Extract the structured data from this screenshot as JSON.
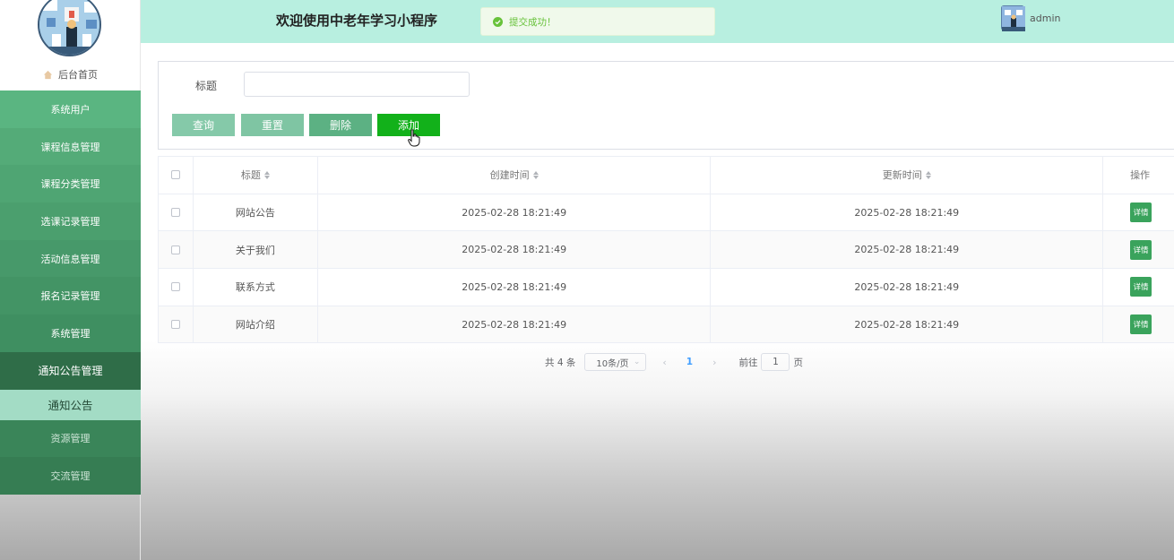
{
  "header": {
    "title": "欢迎使用中老年学习小程序",
    "toast": "提交成功！",
    "username": "admin"
  },
  "sidebar": {
    "home": "后台首页",
    "items": [
      {
        "label": "系统用户"
      },
      {
        "label": "课程信息管理"
      },
      {
        "label": "课程分类管理"
      },
      {
        "label": "选课记录管理"
      },
      {
        "label": "活动信息管理"
      },
      {
        "label": "报名记录管理"
      },
      {
        "label": "系统管理"
      },
      {
        "label": "通知公告管理"
      },
      {
        "label": "通知公告"
      },
      {
        "label": "资源管理"
      },
      {
        "label": "交流管理"
      }
    ]
  },
  "search": {
    "title_label": "标题",
    "title_value": "",
    "buttons": {
      "query": "查询",
      "reset": "重置",
      "delete": "删除",
      "add": "添加"
    }
  },
  "table": {
    "columns": {
      "title": "标题",
      "created": "创建时间",
      "updated": "更新时间",
      "action": "操作"
    },
    "rows": [
      {
        "title": "网站公告",
        "created": "2025-02-28 18:21:49",
        "updated": "2025-02-28 18:21:49",
        "action": "详情"
      },
      {
        "title": "关于我们",
        "created": "2025-02-28 18:21:49",
        "updated": "2025-02-28 18:21:49",
        "action": "详情"
      },
      {
        "title": "联系方式",
        "created": "2025-02-28 18:21:49",
        "updated": "2025-02-28 18:21:49",
        "action": "详情"
      },
      {
        "title": "网站介绍",
        "created": "2025-02-28 18:21:49",
        "updated": "2025-02-28 18:21:49",
        "action": "详情"
      }
    ]
  },
  "pagination": {
    "total": "共 4 条",
    "page_size": "10条/页",
    "current_page": "1",
    "goto_label": "前往",
    "goto_value": "1",
    "goto_unit": "页"
  }
}
